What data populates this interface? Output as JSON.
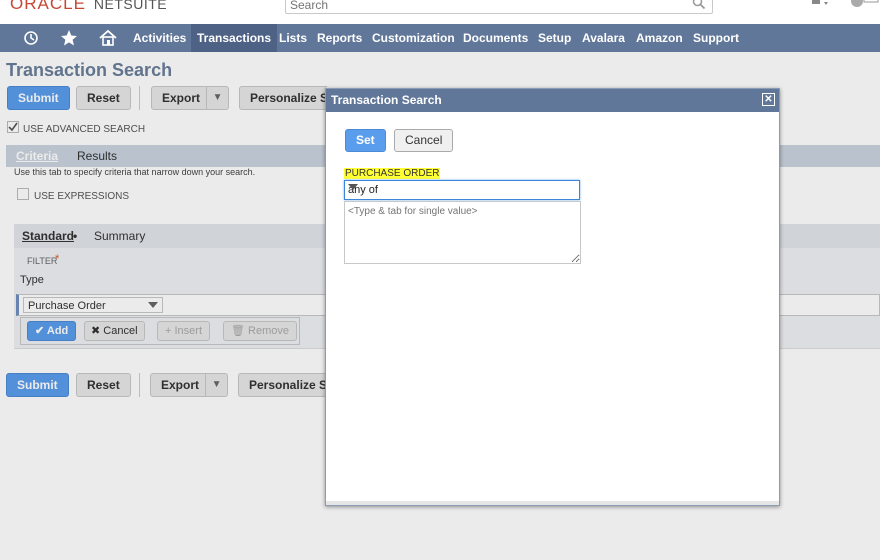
{
  "header": {
    "logo_main": "ORACLE",
    "logo_sub": "NETSUITE",
    "search_placeholder": "Search"
  },
  "nav": {
    "items": [
      "Activities",
      "Transactions",
      "Lists",
      "Reports",
      "Customization",
      "Documents",
      "Setup",
      "Avalara",
      "Amazon",
      "Support"
    ],
    "active": "Transactions"
  },
  "page": {
    "title": "Transaction Search",
    "toolbar": {
      "submit": "Submit",
      "reset": "Reset",
      "export": "Export",
      "personalize": "Personalize Se",
      "personalize_bottom": "Personalize Sea"
    },
    "use_advanced_search": "USE ADVANCED SEARCH",
    "tabs": {
      "criteria": "Criteria",
      "results": "Results"
    },
    "criteria_hint": "Use this tab to specify criteria that narrow down your search.",
    "use_expressions": "USE EXPRESSIONS",
    "subtabs": {
      "standard": "Standard",
      "summary": "Summary"
    },
    "filter_label": "FILTER",
    "required_mark": "*",
    "row_type": "Type",
    "row_value": "Purchase Order",
    "row_buttons": {
      "add": "Add",
      "cancel": "Cancel",
      "insert": "Insert",
      "remove": "Remove"
    }
  },
  "modal": {
    "title": "Transaction Search",
    "set": "Set",
    "cancel": "Cancel",
    "field_label": "PURCHASE ORDER",
    "operator": "any of",
    "value_placeholder": "<Type & tab for single value>"
  },
  "colors": {
    "nav_bg": "#607799",
    "primary_button": "#5b9ded",
    "highlight": "#ffff33",
    "title": "#6a7e99"
  }
}
